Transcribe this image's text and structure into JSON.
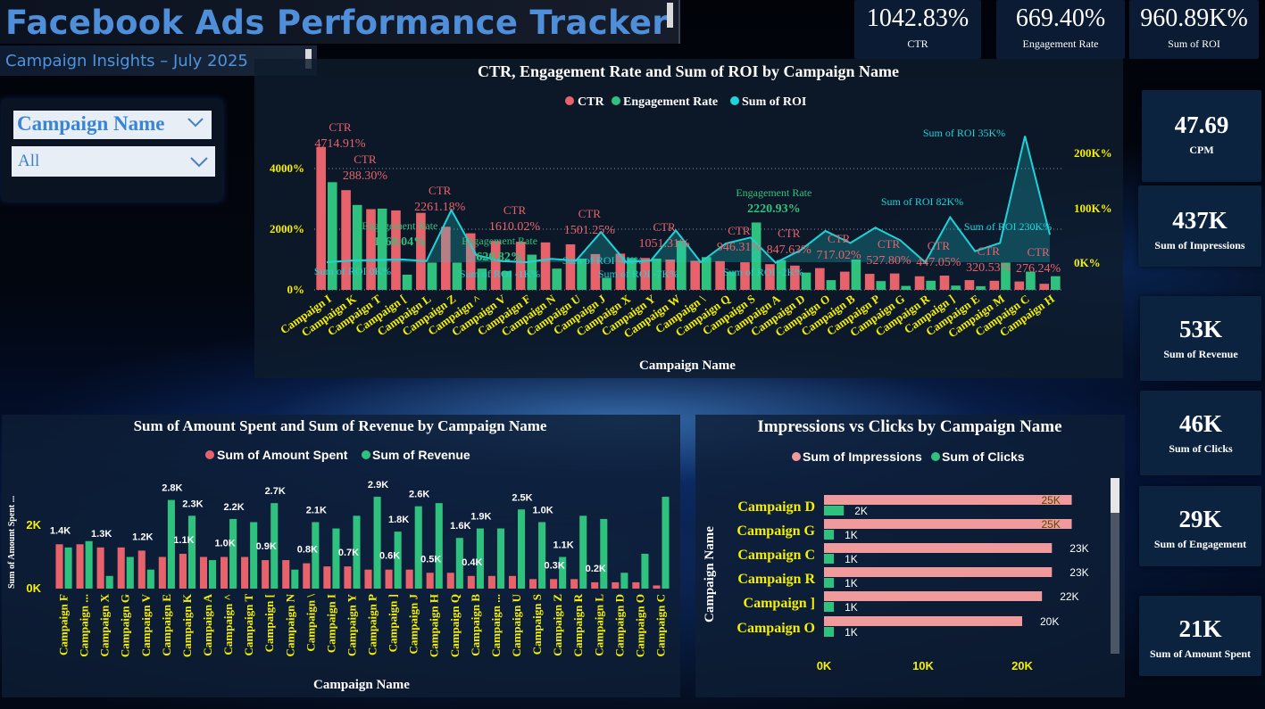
{
  "header": {
    "title": "Facebook Ads Performance Tracker",
    "subtitle": "Campaign Insights – July 2025"
  },
  "kpis_top": [
    {
      "value": "1042.83%",
      "label": "CTR"
    },
    {
      "value": "669.40%",
      "label": "Engagement Rate"
    },
    {
      "value": "960.89K%",
      "label": "Sum of ROI"
    }
  ],
  "kpis_side": [
    {
      "value": "47.69",
      "label": "CPM"
    },
    {
      "value": "437K",
      "label": "Sum of Impressions"
    },
    {
      "value": "53K",
      "label": "Sum of Revenue"
    },
    {
      "value": "46K",
      "label": "Sum of Clicks"
    },
    {
      "value": "29K",
      "label": "Sum of Engagement"
    },
    {
      "value": "21K",
      "label": "Sum of Amount Spent"
    }
  ],
  "slicer": {
    "header": "Campaign Name",
    "selected": "All"
  },
  "colors": {
    "ctr": "#e8626b",
    "engagement": "#2ec27e",
    "roi": "#1fd3d8",
    "spent": "#e8626b",
    "revenue": "#2ec27e",
    "impressions": "#f09a9c",
    "clicks": "#2ec27e",
    "axis_label": "#f5f000"
  },
  "chart_data": [
    {
      "type": "bar",
      "title": "CTR, Engagement Rate and Sum of ROI by Campaign Name",
      "xlabel": "Campaign Name",
      "legend": [
        "CTR",
        "Engagement Rate",
        "Sum of ROI"
      ],
      "legend_position": "top-center",
      "left_axis": {
        "ticks": [
          "0%",
          "2000%",
          "4000%"
        ],
        "ylim": [
          0,
          5000
        ]
      },
      "right_axis": {
        "ticks": [
          "0K%",
          "100K%",
          "200K%"
        ],
        "ylim": [
          -50000,
          250000
        ]
      },
      "categories": [
        "Campaign I",
        "Campaign K",
        "Campaign T",
        "Campaign [",
        "Campaign L",
        "Campaign Z",
        "Campaign ^",
        "Campaign V",
        "Campaign F",
        "Campaign N",
        "Campaign U",
        "Campaign J",
        "Campaign X",
        "Campaign Y",
        "Campaign W",
        "Campaign \\",
        "Campaign Q",
        "Campaign S",
        "Campaign A",
        "Campaign D",
        "Campaign O",
        "Campaign B",
        "Campaign P",
        "Campaign G",
        "Campaign R",
        "Campaign ]",
        "Campaign E",
        "Campaign M",
        "Campaign C",
        "Campaign H"
      ],
      "series": [
        {
          "name": "CTR",
          "kind": "bar",
          "values": [
            4714.91,
            3288.3,
            2661.0,
            2620.0,
            2538.0,
            2081.0,
            1865.0,
            1610.02,
            1585.0,
            1565.0,
            1501.25,
            1180.0,
            1195.0,
            1051.31,
            1000.0,
            960.0,
            946.31,
            910.0,
            847.63,
            800.0,
            717.02,
            600.0,
            527.8,
            540.0,
            447.05,
            470.0,
            320.53,
            300.0,
            276.24,
            200.0
          ]
        },
        {
          "name": "Engagement Rate",
          "kind": "bar",
          "values": [
            3550.0,
            2800.0,
            2680.0,
            500.0,
            900.0,
            900.0,
            700.0,
            620.82,
            1160.04,
            700.0,
            1030.0,
            400.0,
            1050.0,
            1030.0,
            1620.0,
            1080.0,
            600.0,
            2220.93,
            980.0,
            570.0,
            320.0,
            1000.0,
            290.0,
            130.0,
            300.0,
            140.0,
            120.0,
            900.0,
            600.0,
            450.0
          ]
        },
        {
          "name": "Sum of ROI",
          "kind": "line",
          "values": [
            0,
            3000,
            4000,
            5000,
            2000,
            95000,
            13000,
            2000,
            0,
            6000,
            3000,
            55000,
            500,
            3000,
            58000,
            0,
            34000,
            45000,
            -1000,
            22000,
            57000,
            35000,
            63000,
            40000,
            0,
            82000,
            20000,
            35000,
            230000,
            50000
          ]
        }
      ],
      "data_labels": [
        {
          "series": "CTR",
          "text": "4714.91%"
        },
        {
          "series": "CTR",
          "text": "288.30%"
        },
        {
          "series": "CTR",
          "text": "2261.18%"
        },
        {
          "series": "CTR",
          "text": "1610.02%"
        },
        {
          "series": "CTR",
          "text": "1501.25%"
        },
        {
          "series": "CTR",
          "text": "1051.31%"
        },
        {
          "series": "CTR",
          "text": "946.31%"
        },
        {
          "series": "CTR",
          "text": "847.63%"
        },
        {
          "series": "CTR",
          "text": "717.02%"
        },
        {
          "series": "CTR",
          "text": "527.80%"
        },
        {
          "series": "CTR",
          "text": "447.05%"
        },
        {
          "series": "CTR",
          "text": "320.53%"
        },
        {
          "series": "CTR",
          "text": "276.24%"
        },
        {
          "series": "Engagement Rate",
          "text": "1160.04%"
        },
        {
          "series": "Engagement Rate",
          "text": "620.82%"
        },
        {
          "series": "Engagement Rate",
          "text": "2220.93%"
        },
        {
          "series": "Sum of ROI",
          "text": "0K%"
        },
        {
          "series": "Sum of ROI",
          "text": "-1K%"
        },
        {
          "series": "Sum of ROI",
          "text": "-4K%"
        },
        {
          "series": "Sum of ROI",
          "text": "-7K%"
        },
        {
          "series": "Sum of ROI",
          "text": "-2K%"
        },
        {
          "series": "Sum of ROI",
          "text": "82K%"
        },
        {
          "series": "Sum of ROI",
          "text": "35K%"
        },
        {
          "series": "Sum of ROI",
          "text": "230K%"
        }
      ]
    },
    {
      "type": "bar",
      "title": "Sum of Amount Spent and Sum of Revenue by Campaign Name",
      "xlabel": "Campaign Name",
      "ylabel": "Sum of Amount Spent ...",
      "legend": [
        "Sum of Amount Spent",
        "Sum of Revenue"
      ],
      "legend_position": "top-center",
      "yticks": [
        "0K",
        "2K"
      ],
      "ylim": [
        0,
        3200
      ],
      "categories": [
        "Campaign F",
        "Campaign ...",
        "Campaign X",
        "Campaign G",
        "Campaign V",
        "Campaign E",
        "Campaign K",
        "Campaign A",
        "Campaign ^",
        "Campaign T",
        "Campaign [",
        "Campaign N",
        "Campaign \\",
        "Campaign I",
        "Campaign Y",
        "Campaign P",
        "Campaign ]",
        "Campaign J",
        "Campaign H",
        "Campaign Q",
        "Campaign B",
        "Campaign ...",
        "Campaign U",
        "Campaign S",
        "Campaign Z",
        "Campaign R",
        "Campaign L",
        "Campaign D",
        "Campaign O",
        "Campaign C"
      ],
      "series": [
        {
          "name": "Sum of Amount Spent",
          "values": [
            1400,
            1400,
            1300,
            1300,
            1200,
            1000,
            1100,
            1000,
            1000,
            1000,
            900,
            900,
            800,
            700,
            700,
            600,
            600,
            600,
            500,
            500,
            400,
            400,
            400,
            300,
            300,
            300,
            200,
            200,
            200,
            100
          ]
        },
        {
          "name": "Sum of Revenue",
          "values": [
            1300,
            1500,
            400,
            1000,
            600,
            2800,
            2300,
            900,
            2200,
            2100,
            2700,
            600,
            2100,
            1900,
            2300,
            2900,
            1800,
            2600,
            2700,
            1600,
            1900,
            1900,
            2500,
            2100,
            1000,
            2300,
            2200,
            500,
            1100,
            2900
          ]
        }
      ],
      "data_labels": [
        {
          "series": "Sum of Amount Spent",
          "text": "1.4K"
        },
        {
          "series": "Sum of Amount Spent",
          "text": "1.3K"
        },
        {
          "series": "Sum of Amount Spent",
          "text": "1.2K"
        },
        {
          "series": "Sum of Amount Spent",
          "text": "1.1K"
        },
        {
          "series": "Sum of Amount Spent",
          "text": "1.0K"
        },
        {
          "series": "Sum of Amount Spent",
          "text": "0.9K"
        },
        {
          "series": "Sum of Amount Spent",
          "text": "0.8K"
        },
        {
          "series": "Sum of Amount Spent",
          "text": "0.7K"
        },
        {
          "series": "Sum of Amount Spent",
          "text": "0.6K"
        },
        {
          "series": "Sum of Amount Spent",
          "text": "0.5K"
        },
        {
          "series": "Sum of Amount Spent",
          "text": "0.4K"
        },
        {
          "series": "Sum of Amount Spent",
          "text": "0.3K"
        },
        {
          "series": "Sum of Amount Spent",
          "text": "0.2K"
        },
        {
          "series": "Sum of Revenue",
          "text": "2.8K"
        },
        {
          "series": "Sum of Revenue",
          "text": "2.3K"
        },
        {
          "series": "Sum of Revenue",
          "text": "2.2K"
        },
        {
          "series": "Sum of Revenue",
          "text": "2.7K"
        },
        {
          "series": "Sum of Revenue",
          "text": "2.1K"
        },
        {
          "series": "Sum of Revenue",
          "text": "2.9K"
        },
        {
          "series": "Sum of Revenue",
          "text": "1.8K"
        },
        {
          "series": "Sum of Revenue",
          "text": "2.6K"
        },
        {
          "series": "Sum of Revenue",
          "text": "1.6K"
        },
        {
          "series": "Sum of Revenue",
          "text": "1.9K"
        },
        {
          "series": "Sum of Revenue",
          "text": "2.5K"
        },
        {
          "series": "Sum of Revenue",
          "text": "1.0K"
        },
        {
          "series": "Sum of Revenue",
          "text": "1.1K"
        }
      ]
    },
    {
      "type": "bar",
      "orientation": "horizontal",
      "title": "Impressions vs Clicks by Campaign Name",
      "ylabel": "Campaign Name",
      "legend": [
        "Sum of Impressions",
        "Sum of Clicks"
      ],
      "legend_position": "top-center",
      "xticks": [
        "0K",
        "10K",
        "20K"
      ],
      "xlim": [
        0,
        25500
      ],
      "categories": [
        "Campaign D",
        "Campaign G",
        "Campaign C",
        "Campaign R",
        "Campaign ]",
        "Campaign O"
      ],
      "series": [
        {
          "name": "Sum of Impressions",
          "values": [
            25000,
            25000,
            23000,
            23000,
            22000,
            20000
          ],
          "labels": [
            "25K",
            "25K",
            "23K",
            "23K",
            "22K",
            "20K"
          ]
        },
        {
          "name": "Sum of Clicks",
          "values": [
            2000,
            1000,
            1000,
            1000,
            1000,
            1000
          ],
          "labels": [
            "2K",
            "1K",
            "1K",
            "1K",
            "1K",
            "1K"
          ]
        }
      ]
    }
  ]
}
